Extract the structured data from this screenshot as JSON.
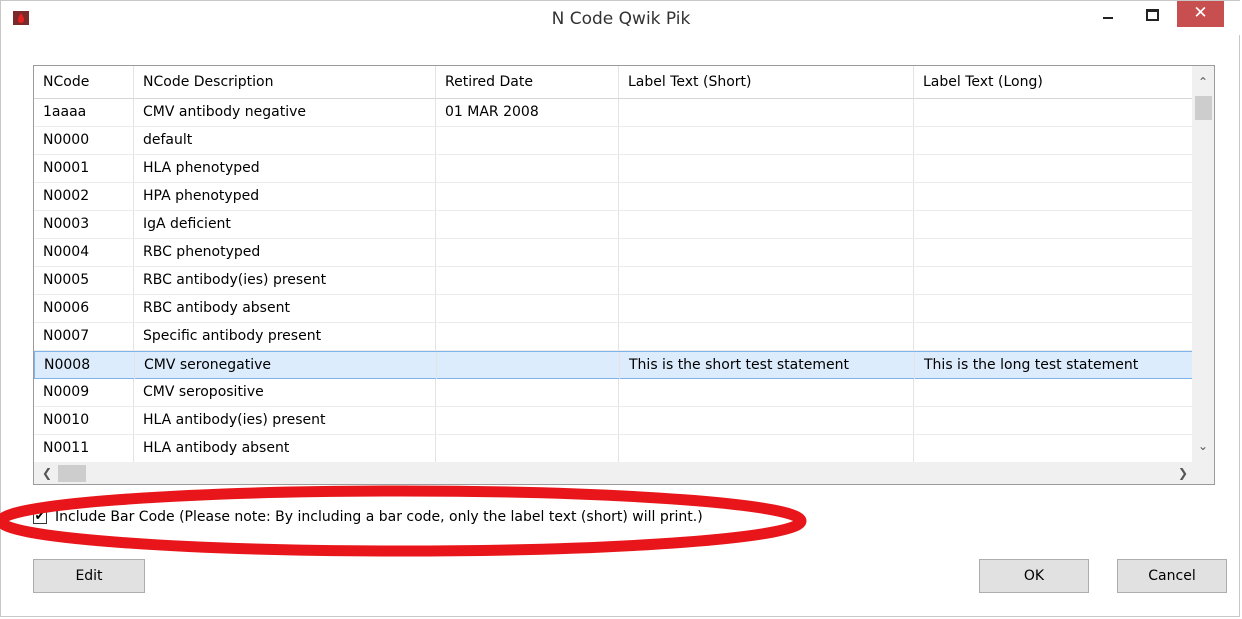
{
  "window": {
    "title": "N Code Qwik Pik",
    "close_label": "✕"
  },
  "table": {
    "columns": [
      "NCode",
      "NCode Description",
      "Retired Date",
      "Label Text (Short)",
      "Label Text (Long)"
    ],
    "rows": [
      [
        "1aaaa",
        "CMV antibody negative",
        "01 MAR 2008",
        "",
        ""
      ],
      [
        "N0000",
        "default",
        "",
        "",
        ""
      ],
      [
        "N0001",
        "HLA phenotyped",
        "",
        "",
        ""
      ],
      [
        "N0002",
        "HPA phenotyped",
        "",
        "",
        ""
      ],
      [
        "N0003",
        "IgA deficient",
        "",
        "",
        ""
      ],
      [
        "N0004",
        "RBC phenotyped",
        "",
        "",
        ""
      ],
      [
        "N0005",
        "RBC antibody(ies) present",
        "",
        "",
        ""
      ],
      [
        "N0006",
        "RBC antibody absent",
        "",
        "",
        ""
      ],
      [
        "N0007",
        "Specific antibody present",
        "",
        "",
        ""
      ],
      [
        "N0008",
        "CMV seronegative",
        "",
        "This is the short test statement",
        "This is the long test statement"
      ],
      [
        "N0009",
        "CMV seropositive",
        "",
        "",
        ""
      ],
      [
        "N0010",
        "HLA antibody(ies) present",
        "",
        "",
        ""
      ],
      [
        "N0011",
        "HLA antibody absent",
        "",
        "",
        ""
      ]
    ],
    "selected_row": 9
  },
  "include_bar_code": {
    "checked": true,
    "check_glyph": "✔",
    "label": "Include Bar Code (Please note: By including a bar code, only the label text (short) will print.)"
  },
  "buttons": {
    "edit": "Edit",
    "ok": "OK",
    "cancel": "Cancel"
  },
  "colors": {
    "highlight": "#e8161a",
    "selected_row": "#dcecfc",
    "close_button": "#c74f4f"
  }
}
